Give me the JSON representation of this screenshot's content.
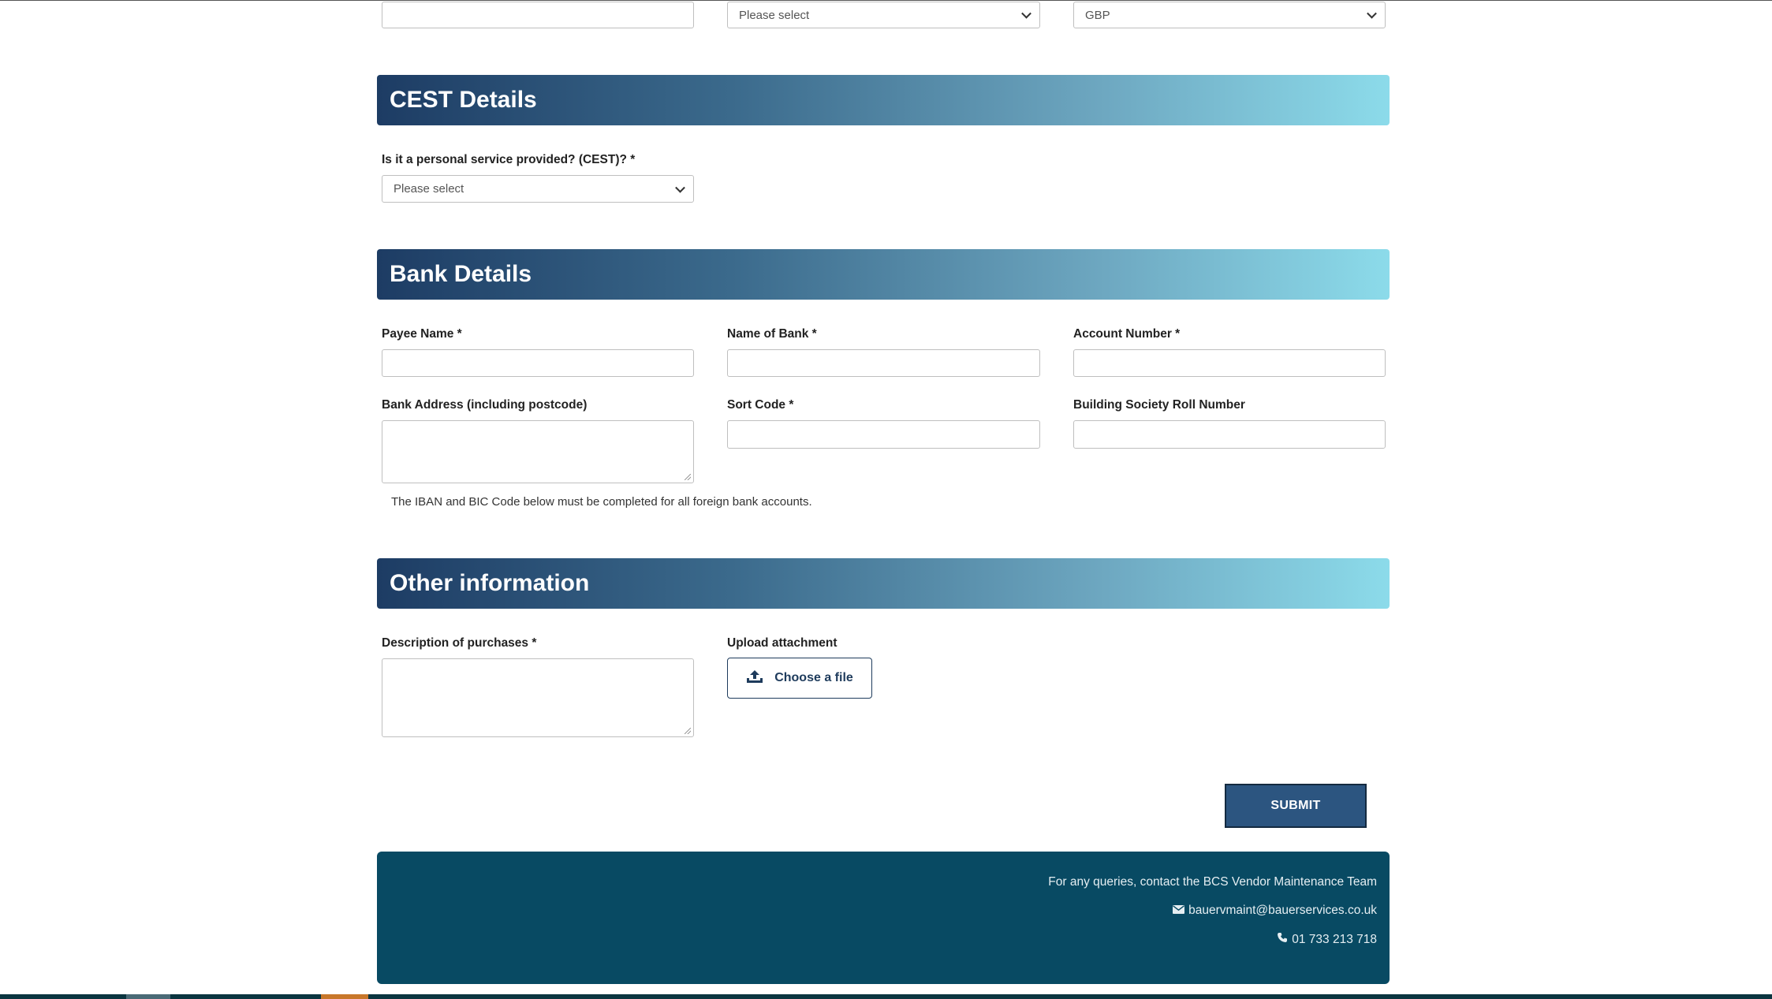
{
  "top_row": {
    "select_1": {
      "value": "Please select"
    },
    "select_2": {
      "value": "GBP"
    }
  },
  "cest": {
    "title": "CEST Details",
    "question_label": "Is it a personal service provided? (CEST)? *",
    "select_value": "Please select"
  },
  "bank": {
    "title": "Bank Details",
    "payee_name_label": "Payee Name *",
    "bank_name_label": "Name of Bank *",
    "account_number_label": "Account Number *",
    "bank_address_label": "Bank Address (including postcode)",
    "sort_code_label": "Sort Code *",
    "roll_number_label": "Building Society Roll Number",
    "iban_note": "The IBAN and BIC Code below must be completed for all foreign bank accounts."
  },
  "other": {
    "title": "Other information",
    "description_label": "Description of purchases *",
    "upload_label": "Upload attachment",
    "upload_button": "Choose a file"
  },
  "submit_label": "SUBMIT",
  "footer": {
    "contact_text": "For any queries, contact the BCS Vendor Maintenance Team",
    "email": "bauervmaint@bauerservices.co.uk",
    "phone": "01 733 213 718"
  },
  "colors": {
    "header_gradient_start": "#1d3c64",
    "header_gradient_end": "#8cdbea",
    "footer_bg": "#084a63",
    "submit_bg": "#2c5580"
  },
  "icons": [
    "chevron-down-icon",
    "upload-icon",
    "envelope-icon",
    "phone-icon"
  ]
}
